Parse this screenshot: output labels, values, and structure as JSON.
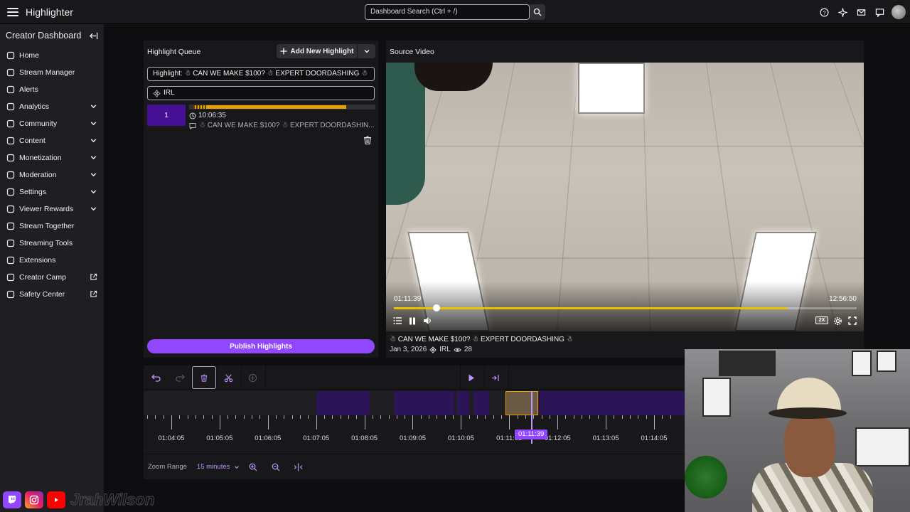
{
  "app": {
    "title": "Highlighter"
  },
  "search": {
    "placeholder": "Dashboard Search (Ctrl + /)"
  },
  "top_icons": [
    "help-icon",
    "sparkle-icon",
    "inbox-icon",
    "chat-bubble-icon"
  ],
  "sidebar": {
    "header": "Creator Dashboard",
    "items": [
      {
        "label": "Home",
        "icon": "home-icon",
        "expandable": false,
        "external": false
      },
      {
        "label": "Stream Manager",
        "icon": "broadcast-icon",
        "expandable": false,
        "external": false
      },
      {
        "label": "Alerts",
        "icon": "alert-icon",
        "expandable": false,
        "external": false
      },
      {
        "label": "Analytics",
        "icon": "analytics-icon",
        "expandable": true,
        "external": false
      },
      {
        "label": "Community",
        "icon": "community-icon",
        "expandable": true,
        "external": false
      },
      {
        "label": "Content",
        "icon": "content-icon",
        "expandable": true,
        "external": false
      },
      {
        "label": "Monetization",
        "icon": "monetization-icon",
        "expandable": true,
        "external": false
      },
      {
        "label": "Moderation",
        "icon": "moderation-icon",
        "expandable": true,
        "external": false
      },
      {
        "label": "Settings",
        "icon": "settings-icon",
        "expandable": true,
        "external": false
      },
      {
        "label": "Viewer Rewards",
        "icon": "rewards-icon",
        "expandable": true,
        "external": false
      },
      {
        "label": "Stream Together",
        "icon": "stream-together-icon",
        "expandable": false,
        "external": false
      },
      {
        "label": "Streaming Tools",
        "icon": "tools-icon",
        "expandable": false,
        "external": false
      },
      {
        "label": "Extensions",
        "icon": "extensions-icon",
        "expandable": false,
        "external": false
      },
      {
        "label": "Creator Camp",
        "icon": "creator-camp-icon",
        "expandable": false,
        "external": true
      },
      {
        "label": "Safety Center",
        "icon": "shield-icon",
        "expandable": false,
        "external": true
      }
    ]
  },
  "queue": {
    "title": "Highlight Queue",
    "add_label": "Add New Highlight",
    "highlight_title": "Highlight: ☃ CAN WE MAKE $100? ☃ EXPERT DOORDASHING ☃",
    "category": "IRL",
    "item": {
      "number": "1",
      "time": "10:06:35",
      "title": "☃ CAN WE MAKE $100? ☃ EXPERT DOORDASHIN..."
    },
    "publish_label": "Publish Highlights"
  },
  "video": {
    "title": "Source Video",
    "current_time": "01:11:39",
    "duration": "12:56:50",
    "progress_fraction": 0.092,
    "buffered_fraction": 0.85,
    "speed": "2X",
    "stream_title": "☃ CAN WE MAKE $100? ☃ EXPERT DOORDASHING ☃",
    "date": "Jan 3, 2026",
    "category": "IRL",
    "views": "28"
  },
  "timeline": {
    "playhead_label": "01:11:39",
    "ticks": [
      "01:04:05",
      "01:05:05",
      "01:06:05",
      "01:07:05",
      "01:08:05",
      "01:09:05",
      "01:10:05",
      "01:11:05",
      "01:12:05",
      "01:13:05",
      "01:14:05"
    ],
    "zoom_label": "Zoom Range",
    "zoom_value": "15 minutes"
  },
  "colors": {
    "accent": "#9147ff",
    "highlight_bar": "#e6a000",
    "background": "#0e0e10",
    "panel": "#18181b"
  }
}
